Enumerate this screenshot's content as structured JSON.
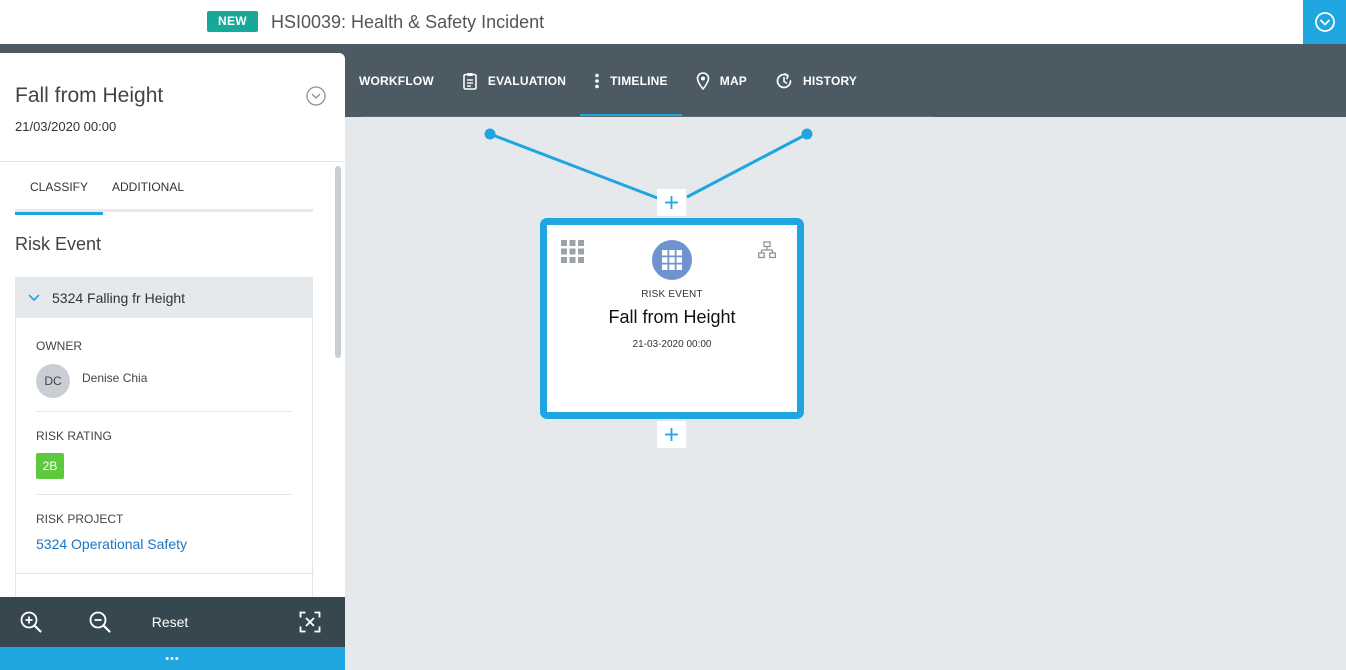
{
  "header": {
    "badge": "NEW",
    "title": "HSI0039: Health & Safety Incident"
  },
  "nav": {
    "tabs": [
      {
        "label": "WORKFLOW",
        "icon": "workflow"
      },
      {
        "label": "EVALUATION",
        "icon": "clipboard-icon"
      },
      {
        "label": "TIMELINE",
        "icon": "vertical-dots-icon",
        "active": true
      },
      {
        "label": "MAP",
        "icon": "map-pin-icon"
      },
      {
        "label": "HISTORY",
        "icon": "history-icon"
      }
    ]
  },
  "panel": {
    "title": "Fall from Height",
    "date": "21/03/2020 00:00",
    "tabs": [
      "CLASSIFY",
      "ADDITIONAL"
    ],
    "active_tab": "CLASSIFY",
    "section_title": "Risk Event",
    "card": {
      "heading": "5324 Falling fr Height",
      "owner_label": "OWNER",
      "owner_initials": "DC",
      "owner_name": "Denise Chia",
      "risk_rating_label": "RISK RATING",
      "risk_rating": "2B",
      "risk_project_label": "RISK PROJECT",
      "risk_project": "5324 Operational Safety"
    }
  },
  "toolbar": {
    "reset_label": "Reset",
    "more_label": "•••"
  },
  "timeline": {
    "node": {
      "type": "RISK EVENT",
      "title": "Fall from Height",
      "date": "21-03-2020 00:00"
    }
  },
  "colors": {
    "accent": "#1fa6e0",
    "nav_bg": "#4b5a63",
    "badge_new": "#17a89a",
    "rating_green": "#5cc93e",
    "link": "#1a75c2"
  }
}
